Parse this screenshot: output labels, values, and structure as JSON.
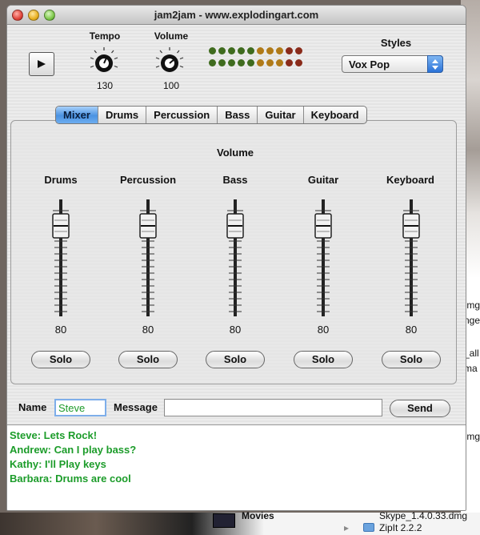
{
  "window": {
    "title": "jam2jam - www.explodingart.com"
  },
  "transport": {
    "tempo_label": "Tempo",
    "tempo_value": "130",
    "volume_label": "Volume",
    "volume_value": "100"
  },
  "styles": {
    "label": "Styles",
    "selected": "Vox Pop"
  },
  "tabs": [
    "Mixer",
    "Drums",
    "Percussion",
    "Bass",
    "Guitar",
    "Keyboard"
  ],
  "mixer": {
    "heading": "Volume",
    "channels": [
      {
        "name": "Drums",
        "value": "80",
        "solo": "Solo"
      },
      {
        "name": "Percussion",
        "value": "80",
        "solo": "Solo"
      },
      {
        "name": "Bass",
        "value": "80",
        "solo": "Solo"
      },
      {
        "name": "Guitar",
        "value": "80",
        "solo": "Solo"
      },
      {
        "name": "Keyboard",
        "value": "80",
        "solo": "Solo"
      }
    ]
  },
  "chat": {
    "name_label": "Name",
    "name_value": "Steve",
    "message_label": "Message",
    "message_value": "",
    "send_label": "Send",
    "messages": [
      "Steve: Lets Rock!",
      "Andrew: Can I play bass?",
      "Kathy: I'll Play keys",
      "Barbara: Drums are cool"
    ]
  },
  "desktop": {
    "frag_1": "Img",
    "frag_2": "nge",
    "frag_3": "_all",
    "frag_4": "ma",
    "frag_5": "Img",
    "movies": "Movies",
    "skype": "Skype_1.4.0.33.dmg",
    "zipit": "ZipIt 2.2.2"
  },
  "colors": {
    "accent": "#4a92e2",
    "chat_text": "#1c9c2a",
    "led_green": "#3f6b1e",
    "led_red": "#8a2b1a",
    "led_amber": "#b07a18"
  }
}
